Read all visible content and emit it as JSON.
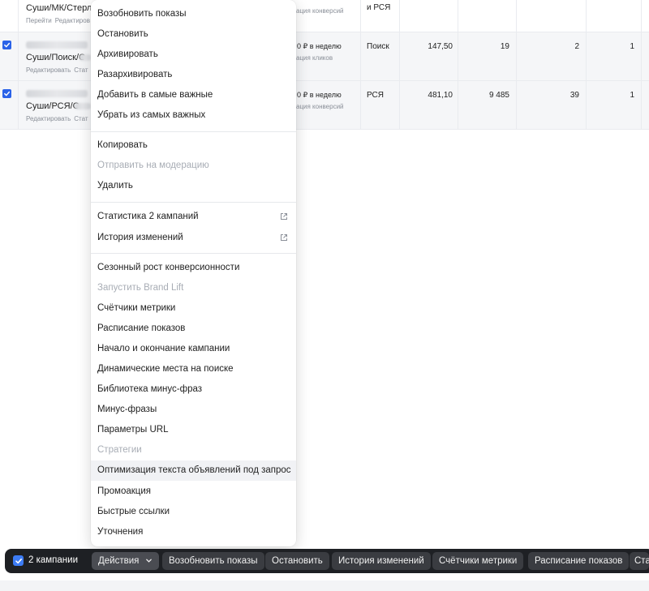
{
  "table": {
    "rows": [
      {
        "name": "Суши/МК/Стерли",
        "links": [
          "Перейти",
          "Редактиров"
        ],
        "budget": "",
        "budget_sub": "ация конверсий",
        "type": "и РСЯ",
        "cost": "",
        "impressions": "",
        "clicks": "",
        "conversions": "",
        "checked": false
      },
      {
        "name": "Суши/Поиск/С",
        "links": [
          "Редактировать",
          "Стат"
        ],
        "budget": "0 ₽ в неделю",
        "budget_sub": "ация кликов",
        "type": "Поиск",
        "cost": "147,50",
        "impressions": "19",
        "clicks": "2",
        "conversions": "1",
        "checked": true
      },
      {
        "name": "Суши/РСЯ/С",
        "links": [
          "Редактировать",
          "Стат"
        ],
        "budget": "0 ₽ в неделю",
        "budget_sub": "ация конверсий",
        "type": "РСЯ",
        "cost": "481,10",
        "impressions": "9 485",
        "clicks": "39",
        "conversions": "1",
        "checked": true
      }
    ]
  },
  "menu": {
    "group1": [
      "Возобновить показы",
      "Остановить",
      "Архивировать",
      "Разархивировать",
      "Добавить в самые важные",
      "Убрать из самых важных"
    ],
    "group2": [
      {
        "label": "Копировать",
        "disabled": false
      },
      {
        "label": "Отправить на модерацию",
        "disabled": true
      },
      {
        "label": "Удалить",
        "disabled": false
      }
    ],
    "group3": [
      {
        "label": "Статистика 2 кампаний",
        "icon": "external-link-icon"
      },
      {
        "label": "История изменений",
        "icon": "external-link-icon"
      }
    ],
    "group4": [
      {
        "label": "Сезонный рост конверсионности",
        "disabled": false
      },
      {
        "label": "Запустить Brand Lift",
        "disabled": true
      },
      {
        "label": "Счётчики метрики",
        "disabled": false
      },
      {
        "label": "Расписание показов",
        "disabled": false
      },
      {
        "label": "Начало и окончание кампании",
        "disabled": false
      },
      {
        "label": "Динамические места на поиске",
        "disabled": false
      },
      {
        "label": "Библиотека минус-фраз",
        "disabled": false
      },
      {
        "label": "Минус-фразы",
        "disabled": false
      },
      {
        "label": "Параметры URL",
        "disabled": false
      },
      {
        "label": "Стратегии",
        "disabled": true
      },
      {
        "label": "Оптимизация текста объявлений под запрос",
        "disabled": false,
        "highlighted": true
      },
      {
        "label": "Промоакция",
        "disabled": false
      },
      {
        "label": "Быстрые ссылки",
        "disabled": false
      },
      {
        "label": "Уточнения",
        "disabled": false
      }
    ]
  },
  "action_bar": {
    "selected_count": "2 кампании",
    "actions_label": "Действия",
    "buttons": [
      "Возобновить показы",
      "Остановить",
      "История изменений",
      "Счётчики метрики",
      "Расписание показов",
      "Ста"
    ]
  },
  "colors": {
    "accent": "#2a62e8",
    "bar_bg": "#1e2024",
    "disabled_text": "#a8adb5"
  }
}
